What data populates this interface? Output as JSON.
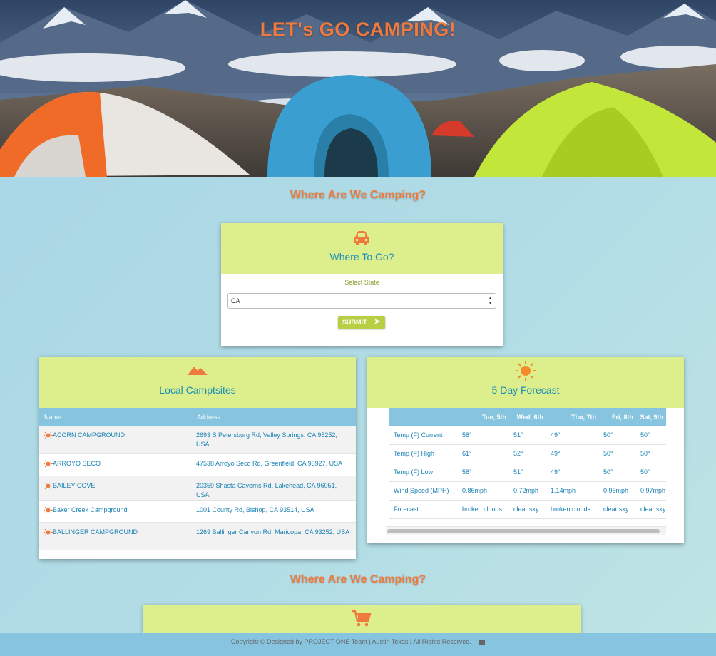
{
  "hero": {
    "title": "LET's GO CAMPING!"
  },
  "section1": {
    "heading": "Where Are We Camping?"
  },
  "where_card": {
    "title": "Where To Go?",
    "icon": "car-icon",
    "select_label": "Select State",
    "select_value": "CA",
    "submit_label": "SUBMIT"
  },
  "campsites": {
    "title": "Local Camptsites",
    "icon": "mountain-icon",
    "columns": [
      "Name",
      "Address"
    ],
    "rows": [
      {
        "name": "ACORN CAMPGROUND",
        "address": "2693 S Petersburg Rd, Valley Springs, CA 95252, USA"
      },
      {
        "name": "ARROYO SECO",
        "address": "47538 Arroyo Seco Rd, Greenfield, CA 93927, USA"
      },
      {
        "name": "BAILEY COVE",
        "address": "20359 Shasta Caverns Rd, Lakehead, CA 96051, USA"
      },
      {
        "name": "Baker Creek Campground",
        "address": "1001 County Rd, Bishop, CA 93514, USA"
      },
      {
        "name": "BALLINGER CAMPGROUND",
        "address": "1269 Ballinger Canyon Rd, Maricopa, CA 93252, USA"
      }
    ]
  },
  "forecast": {
    "title": "5 Day Forecast",
    "icon": "sun-icon",
    "days": [
      "Tue, 5th",
      "Wed, 6th",
      "Thu, 7th",
      "Fri, 8th",
      "Sat, 9th"
    ],
    "rows": [
      {
        "label": "Temp (F) Current",
        "values": [
          "58°",
          "51°",
          "49°",
          "50°",
          "50°"
        ]
      },
      {
        "label": "Temp (F) High",
        "values": [
          "61°",
          "52°",
          "49°",
          "50°",
          "50°"
        ]
      },
      {
        "label": "Temp (F) Low",
        "values": [
          "58°",
          "51°",
          "49°",
          "50°",
          "50°"
        ]
      },
      {
        "label": "Wind Speed (MPH)",
        "values": [
          "0.86mph",
          "0.72mph",
          "1.14mph",
          "0.95mph",
          "0.97mph"
        ]
      },
      {
        "label": "Forecast",
        "values": [
          "broken clouds",
          "clear sky",
          "broken clouds",
          "clear sky",
          "clear sky"
        ]
      }
    ]
  },
  "section2": {
    "heading": "Where Are We Camping?"
  },
  "cart_card": {
    "icon": "cart-icon"
  },
  "footer": {
    "text": "Copyright © Designed by PROJECT ONE Team | Austin Texas | All Rights Reserved. |"
  },
  "colors": {
    "accent": "#ef7a3c",
    "link": "#1a82b5",
    "header_bg": "#ddee8c",
    "table_head": "#86c4df",
    "button": "#b8cf44"
  }
}
